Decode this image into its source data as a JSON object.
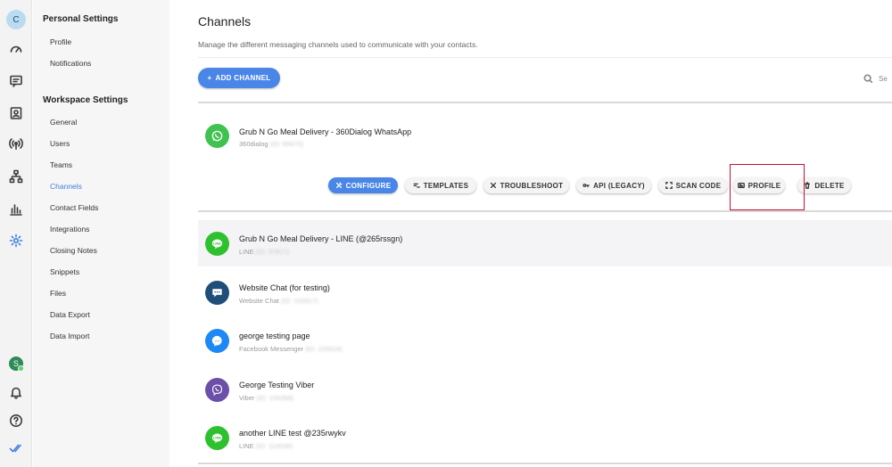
{
  "rail": {
    "user_initial": "C",
    "bottom_user_initial": "S"
  },
  "nav": {
    "personal_header": "Personal Settings",
    "personal_items": [
      "Profile",
      "Notifications"
    ],
    "workspace_header": "Workspace Settings",
    "workspace_items": [
      "General",
      "Users",
      "Teams",
      "Channels",
      "Contact Fields",
      "Integrations",
      "Closing Notes",
      "Snippets",
      "Files",
      "Data Export",
      "Data Import"
    ],
    "active_item": "Channels"
  },
  "main": {
    "title": "Channels",
    "description": "Manage the different messaging channels used to communicate with your contacts.",
    "add_channel_label": "ADD CHANNEL",
    "search_placeholder": "Se"
  },
  "expanded_channel": {
    "name": "Grub N Go Meal Delivery - 360Dialog WhatsApp",
    "type": "360dialog",
    "id_text": "(ID: 89470)",
    "icon": "whatsapp-icon",
    "color": "#3fc24f",
    "actions": [
      {
        "label": "CONFIGURE",
        "icon": "wrench-icon"
      },
      {
        "label": "TEMPLATES",
        "icon": "templates-icon"
      },
      {
        "label": "TROUBLESHOOT",
        "icon": "tools-icon"
      },
      {
        "label": "API (LEGACY)",
        "icon": "key-icon"
      },
      {
        "label": "SCAN CODE",
        "icon": "scan-icon"
      },
      {
        "label": "PROFILE",
        "icon": "profile-card-icon"
      },
      {
        "label": "DELETE",
        "icon": "trash-icon"
      }
    ]
  },
  "channels": [
    {
      "name": "Grub N Go Meal Delivery - LINE (@265rssgn)",
      "type": "LINE",
      "id_text": "(ID: 97827)",
      "icon": "line-icon",
      "color": "#2fc02f"
    },
    {
      "name": "Website Chat (for testing)",
      "type": "Website Chat",
      "id_text": "(ID: 102917)",
      "icon": "chat-bubble-icon",
      "color": "#1f4e79"
    },
    {
      "name": "george testing page",
      "type": "Facebook Messenger",
      "id_text": "(ID: 105624)",
      "icon": "messenger-icon",
      "color": "#1e88f5"
    },
    {
      "name": "George Testing Viber",
      "type": "Viber",
      "id_text": "(ID: 106358)",
      "icon": "viber-icon",
      "color": "#6b4fa8"
    },
    {
      "name": "another LINE test @235rwykv",
      "type": "LINE",
      "id_text": "(ID: 110036)",
      "icon": "line-icon",
      "color": "#2fc02f"
    }
  ]
}
